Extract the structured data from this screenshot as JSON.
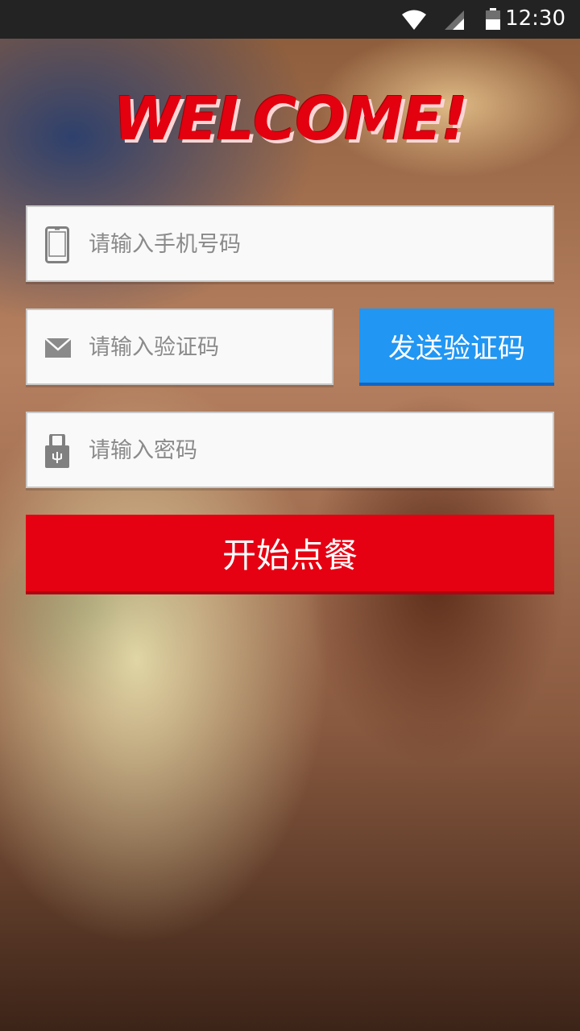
{
  "status_bar": {
    "time": "12:30",
    "icons": [
      "wifi-icon",
      "signal-icon",
      "battery-icon"
    ]
  },
  "header": {
    "welcome": "WELCOME!"
  },
  "form": {
    "phone": {
      "placeholder": "请输入手机号码",
      "icon": "phone-icon",
      "value": ""
    },
    "code": {
      "placeholder": "请输入验证码",
      "icon": "mail-icon",
      "value": ""
    },
    "send_code_label": "发送验证码",
    "password": {
      "placeholder": "请输入密码",
      "icon": "lock-icon",
      "value": ""
    },
    "start_label": "开始点餐"
  },
  "colors": {
    "accent_red": "#e50012",
    "accent_blue": "#2196f3",
    "status_bar": "#232323"
  }
}
